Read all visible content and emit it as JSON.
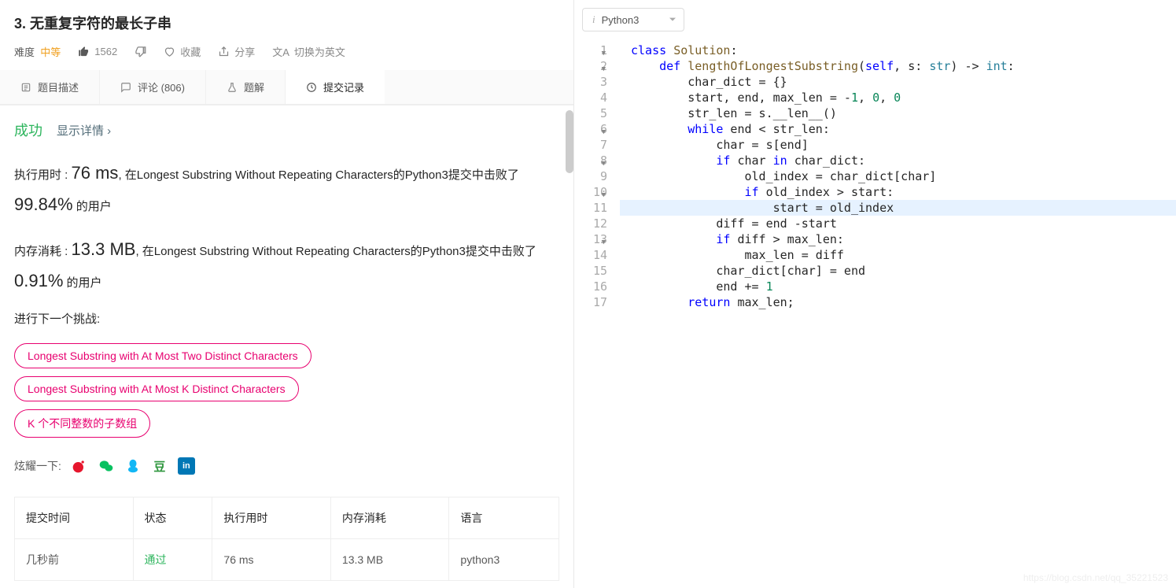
{
  "header": {
    "title": "3. 无重复字符的最长子串",
    "difficulty_label": "难度",
    "difficulty_value": "中等",
    "likes": "1562",
    "fav": "收藏",
    "share": "分享",
    "switch": "切换为英文"
  },
  "tabs": {
    "desc": "题目描述",
    "comments": "评论 (806)",
    "solution": "题解",
    "submissions": "提交记录"
  },
  "result": {
    "success": "成功",
    "detail": "显示详情 ›",
    "time_label": "执行用时 : ",
    "time_value": "76 ms",
    "time_suffix": ", 在Longest Substring Without Repeating Characters的Python3提交中击败了",
    "time_pct": "99.84%",
    "time_tail": " 的用户",
    "mem_label": "内存消耗 : ",
    "mem_value": "13.3 MB",
    "mem_suffix": ", 在Longest Substring Without Repeating Characters的Python3提交中击败了",
    "mem_pct": "0.91%",
    "mem_tail": " 的用户",
    "next": "进行下一个挑战:",
    "pill1": "Longest Substring with At Most Two Distinct Characters",
    "pill2": "Longest Substring with At Most K Distinct Characters",
    "pill3": "K 个不同整数的子数组",
    "brag": "炫耀一下:"
  },
  "table": {
    "h1": "提交时间",
    "h2": "状态",
    "h3": "执行用时",
    "h4": "内存消耗",
    "h5": "语言",
    "r1c1": "几秒前",
    "r1c2": "通过",
    "r1c3": "76 ms",
    "r1c4": "13.3 MB",
    "r1c5": "python3"
  },
  "editor": {
    "language": "Python3",
    "lines": [
      "class Solution:",
      "    def lengthOfLongestSubstring(self, s: str) -> int:",
      "        char_dict = {}",
      "        start, end, max_len = -1, 0, 0",
      "        str_len = s.__len__()",
      "        while end < str_len:",
      "            char = s[end]",
      "            if char in char_dict:",
      "                old_index = char_dict[char]",
      "                if old_index > start:",
      "                    start = old_index",
      "            diff = end -start",
      "            if diff > max_len:",
      "                max_len = diff",
      "            char_dict[char] = end",
      "            end += 1",
      "        return max_len;"
    ],
    "highlighted_line": 11,
    "fold_lines": [
      1,
      2,
      6,
      8,
      10,
      13
    ]
  },
  "watermark": "https://blog.csdn.net/qq_35221523"
}
